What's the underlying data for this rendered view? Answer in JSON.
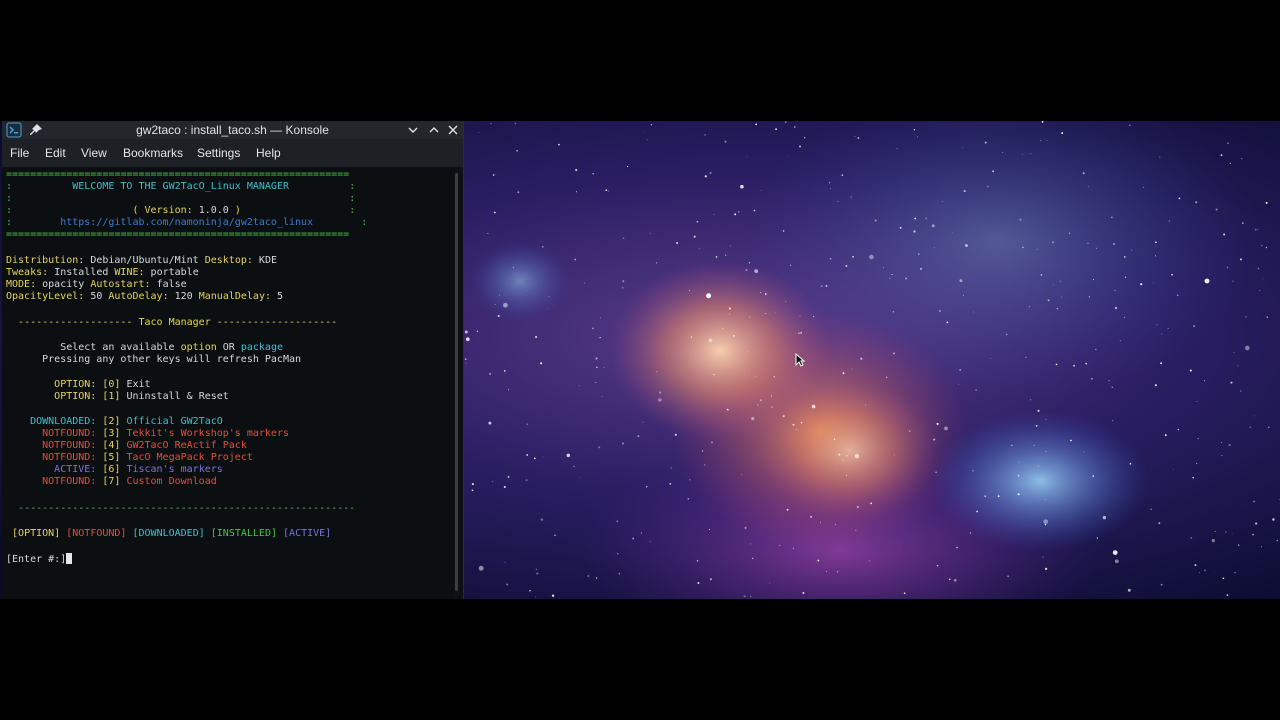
{
  "window": {
    "title": "gw2taco : install_taco.sh — Konsole",
    "icons": [
      "konsole-app-icon",
      "pin-icon",
      "minimize-icon",
      "maximize-icon",
      "close-icon"
    ]
  },
  "menubar": {
    "items": [
      "File",
      "Edit",
      "View",
      "Bookmarks",
      "Settings",
      "Help"
    ]
  },
  "terminal": {
    "border": "=========================================================",
    "colon": ":",
    "welcome": "WELCOME TO THE GW2TacO_Linux MANAGER",
    "version_open": "( Version: ",
    "version_num": "1.0.0",
    "version_close": " )",
    "url": "https://gitlab.com/namoninja/gw2taco_linux",
    "info": {
      "distribution_label": "Distribution:",
      "distribution_value": "Debian/Ubuntu/Mint",
      "desktop_label": "Desktop:",
      "desktop_value": "KDE",
      "tweaks_label": "Tweaks:",
      "tweaks_value": "Installed",
      "wine_label": "WINE:",
      "wine_value": "portable",
      "mode_label": "MODE:",
      "mode_value": "opacity",
      "autostart_label": "Autostart:",
      "autostart_value": "false",
      "opacitylevel_label": "OpacityLevel:",
      "opacitylevel_value": "50",
      "autodelay_label": "AutoDelay:",
      "autodelay_value": "120",
      "manualdelay_label": "ManualDelay:",
      "manualdelay_value": "5"
    },
    "section_left": "-------------------",
    "section_title": "Taco Manager",
    "section_right": "--------------------",
    "prompt1_a": "Select an available",
    "prompt1_option": "option",
    "prompt1_or": "OR",
    "prompt1_package": "package",
    "prompt2": "Pressing any other keys will refresh PacMan",
    "options": [
      {
        "status": "OPTION:",
        "num": "[0]",
        "label": "Exit"
      },
      {
        "status": "OPTION:",
        "num": "[1]",
        "label": "Uninstall & Reset"
      }
    ],
    "packages": [
      {
        "status": "DOWNLOADED:",
        "num": "[2]",
        "label": "Official GW2TacO"
      },
      {
        "status": "NOTFOUND:",
        "num": "[3]",
        "label": "Tekkit's Workshop's markers"
      },
      {
        "status": "NOTFOUND:",
        "num": "[4]",
        "label": "GW2TacO ReActif Pack"
      },
      {
        "status": "NOTFOUND:",
        "num": "[5]",
        "label": "TacO MegaPack Project"
      },
      {
        "status": "ACTIVE:",
        "num": "[6]",
        "label": "Tiscan's markers"
      },
      {
        "status": "NOTFOUND:",
        "num": "[7]",
        "label": "Custom Download"
      }
    ],
    "divider": "--------------------------------------------------------",
    "legend": [
      "[OPTION]",
      "[NOTFOUND]",
      "[DOWNLOADED]",
      "[INSTALLED]",
      "[ACTIVE]"
    ],
    "input_prompt": "[Enter #:]"
  },
  "colors": {
    "green": "#4fc04f",
    "yellow": "#e6d35a",
    "cyan": "#3fbfcf",
    "red": "#e0503a",
    "violet": "#7a73d9",
    "blue": "#3a7bd5"
  }
}
